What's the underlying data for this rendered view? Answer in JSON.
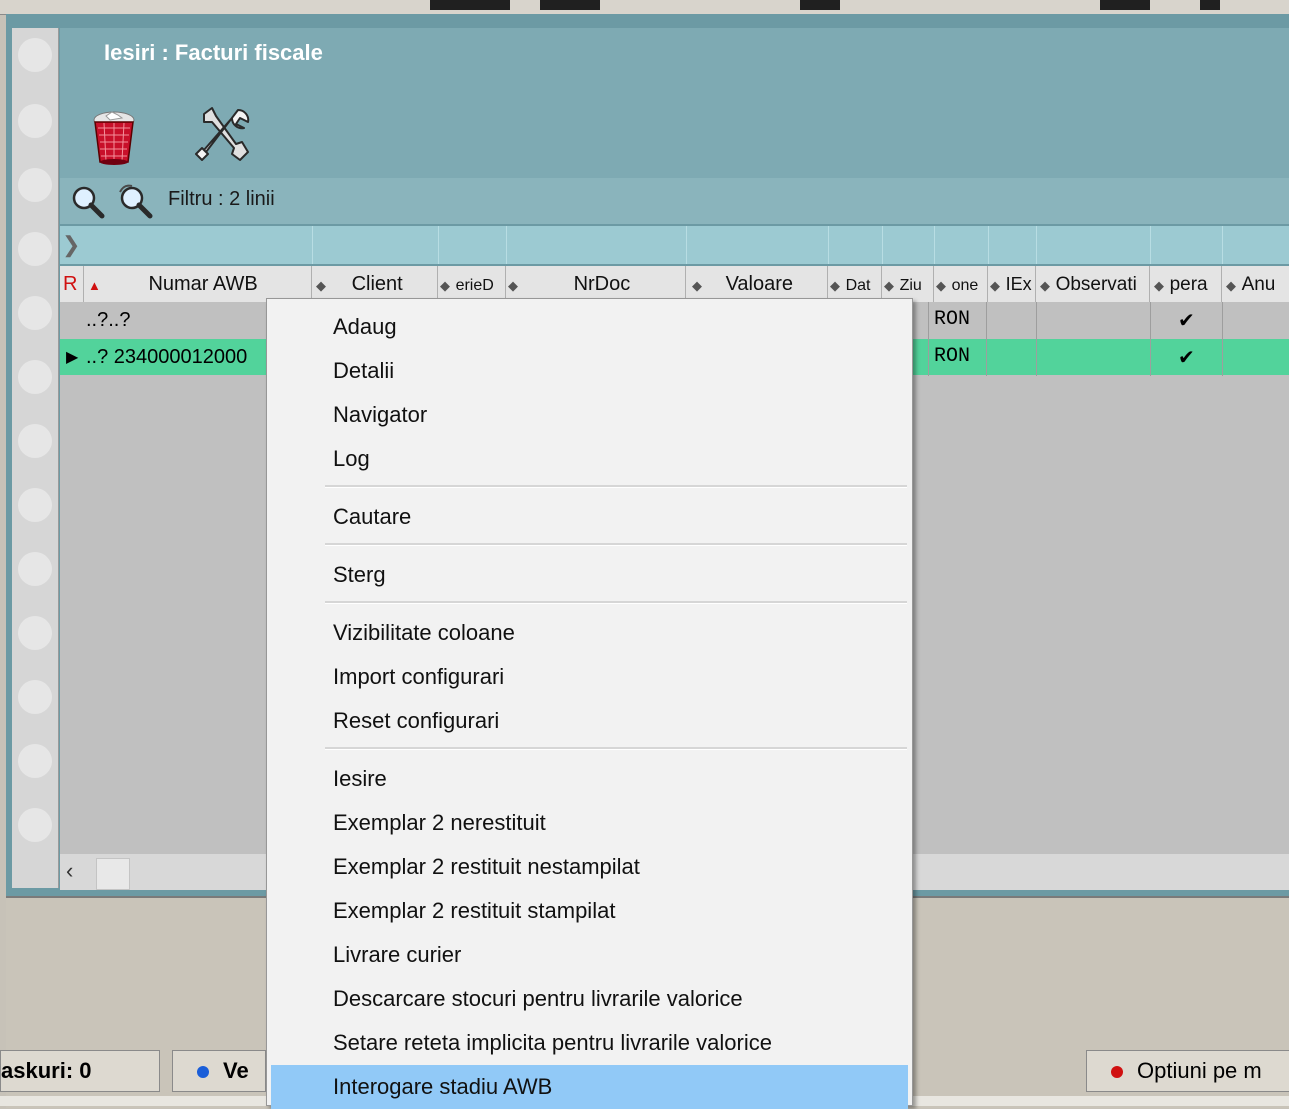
{
  "window": {
    "title": "Iesiri : Facturi fiscale",
    "filter_text": "Filtru : 2 linii"
  },
  "toolbar": {
    "delete_icon": "trash-icon",
    "settings_icon": "tools-icon",
    "search_icon": "zoom-icon",
    "search_advanced_icon": "zoom-advanced-icon"
  },
  "grid": {
    "marker": "R",
    "columns": [
      "Numar AWB",
      "Client",
      "SerieDoc",
      "NrDoc",
      "Valoare",
      "Data",
      "Ziua",
      "Moneda",
      "IEx",
      "Observatii",
      "Operat",
      "Anulat"
    ],
    "column_labels_visible": [
      "Numar AWB",
      "Client",
      "erieD",
      "NrDoc",
      "Valoare",
      "Dat",
      "Ziu",
      "one",
      "IEx",
      "Observati",
      "pera",
      "Anu"
    ],
    "rows": [
      {
        "awb": "..?..?",
        "currency": "RON",
        "operat": "✔"
      },
      {
        "awb": "..? 234000012000",
        "currency": "RON",
        "operat": "✔"
      }
    ]
  },
  "context_menu": {
    "items": [
      {
        "label": "Adaug"
      },
      {
        "label": "Detalii"
      },
      {
        "label": "Navigator"
      },
      {
        "label": "Log"
      },
      {
        "label": "Cautare"
      },
      {
        "label": "Sterg"
      },
      {
        "label": "Vizibilitate coloane"
      },
      {
        "label": "Import configurari"
      },
      {
        "label": "Reset configurari"
      },
      {
        "label": "Iesire"
      },
      {
        "label": "Exemplar 2 nerestituit"
      },
      {
        "label": "Exemplar 2 restituit nestampilat"
      },
      {
        "label": "Exemplar 2 restituit stampilat"
      },
      {
        "label": "Livrare curier"
      },
      {
        "label": "Descarcare stocuri pentru livrarile valorice"
      },
      {
        "label": "Setare reteta implicita pentru livrarile valorice"
      },
      {
        "label": "Interogare stadiu AWB"
      }
    ],
    "highlighted": "Interogare stadiu AWB"
  },
  "status_bar": {
    "tasks": "askuri: 0",
    "middle_button": "Ve",
    "right_button": "Optiuni pe m"
  },
  "colors": {
    "window_bg": "#6c9aa4",
    "title_bg": "#7eaab3",
    "selected_row": "#52d39b",
    "menu_highlight": "#91c9f7"
  }
}
